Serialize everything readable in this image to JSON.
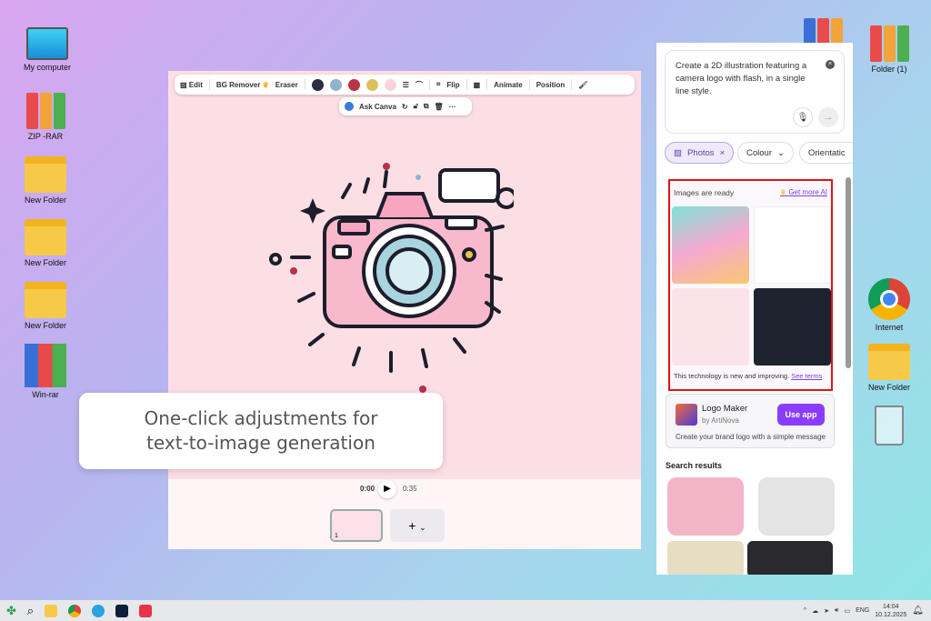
{
  "desktop": {
    "left_icons": [
      "My computer",
      "ZIP -RAR",
      "New Folder",
      "New Folder",
      "New Folder",
      "Win-rar"
    ],
    "right_icons": [
      "Folder (1)",
      "Internet",
      "New Folder"
    ]
  },
  "toolbar": {
    "edit": "Edit",
    "bg_remover": "BG Remover",
    "eraser": "Eraser",
    "flip": "Flip",
    "animate": "Animate",
    "position": "Position",
    "colors": [
      "#2b2d42",
      "#8fb3cc",
      "#b8324a",
      "#dcc15a",
      "#fbd3dc"
    ]
  },
  "subtoolbar": {
    "ask": "Ask Canva"
  },
  "timeline": {
    "current": "0:00",
    "total": "0:35",
    "page": "1",
    "add": "+"
  },
  "callout": {
    "line1": "One-click adjustments for",
    "line2": "text-to-image generation"
  },
  "panel": {
    "prompt": "Create a 2D illustration featuring a camera logo with flash, in a single line style.",
    "chips": [
      "Photos",
      "Colour",
      "Orientatic"
    ],
    "ready_title": "Images are ready",
    "get_more": "Get more AI",
    "disclaimer": "This technology is new and improving.",
    "see_terms": "See terms",
    "app": {
      "name": "Logo Maker",
      "by": "by ArtiNova",
      "button": "Use app",
      "desc": "Create your brand logo with a simple message"
    },
    "search_results": "Search results"
  },
  "taskbar": {
    "lang": "ENG",
    "time": "14:04",
    "date": "10.12.2025"
  }
}
